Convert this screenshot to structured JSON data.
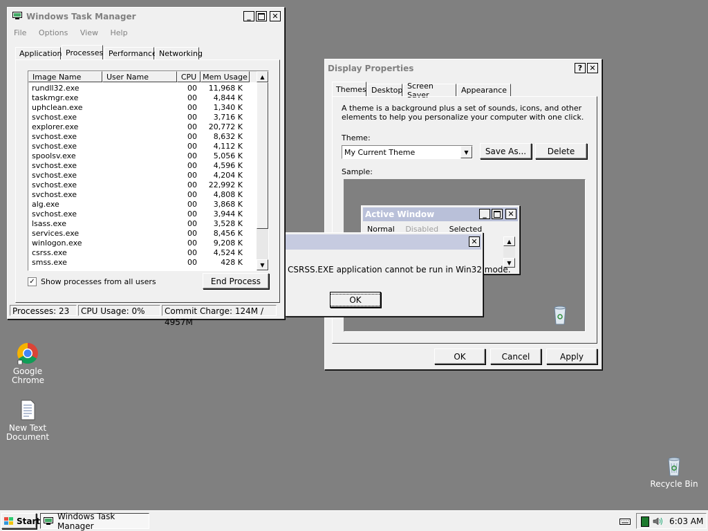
{
  "task_manager": {
    "title": "Windows Task Manager",
    "menu": [
      "File",
      "Options",
      "View",
      "Help"
    ],
    "tabs": [
      "Applications",
      "Processes",
      "Performance",
      "Networking"
    ],
    "columns": [
      "Image Name",
      "User Name",
      "CPU",
      "Mem Usage"
    ],
    "rows": [
      {
        "name": "rundll32.exe",
        "user": "",
        "cpu": "00",
        "mem": "11,968 K"
      },
      {
        "name": "taskmgr.exe",
        "user": "",
        "cpu": "00",
        "mem": "4,844 K"
      },
      {
        "name": "uphclean.exe",
        "user": "",
        "cpu": "00",
        "mem": "1,340 K"
      },
      {
        "name": "svchost.exe",
        "user": "",
        "cpu": "00",
        "mem": "3,716 K"
      },
      {
        "name": "explorer.exe",
        "user": "",
        "cpu": "00",
        "mem": "20,772 K"
      },
      {
        "name": "svchost.exe",
        "user": "",
        "cpu": "00",
        "mem": "8,632 K"
      },
      {
        "name": "svchost.exe",
        "user": "",
        "cpu": "00",
        "mem": "4,112 K"
      },
      {
        "name": "spoolsv.exe",
        "user": "",
        "cpu": "00",
        "mem": "5,056 K"
      },
      {
        "name": "svchost.exe",
        "user": "",
        "cpu": "00",
        "mem": "4,596 K"
      },
      {
        "name": "svchost.exe",
        "user": "",
        "cpu": "00",
        "mem": "4,204 K"
      },
      {
        "name": "svchost.exe",
        "user": "",
        "cpu": "00",
        "mem": "22,992 K"
      },
      {
        "name": "svchost.exe",
        "user": "",
        "cpu": "00",
        "mem": "4,808 K"
      },
      {
        "name": "alg.exe",
        "user": "",
        "cpu": "00",
        "mem": "3,868 K"
      },
      {
        "name": "svchost.exe",
        "user": "",
        "cpu": "00",
        "mem": "3,944 K"
      },
      {
        "name": "lsass.exe",
        "user": "",
        "cpu": "00",
        "mem": "3,528 K"
      },
      {
        "name": "services.exe",
        "user": "",
        "cpu": "00",
        "mem": "8,456 K"
      },
      {
        "name": "winlogon.exe",
        "user": "",
        "cpu": "00",
        "mem": "9,208 K"
      },
      {
        "name": "csrss.exe",
        "user": "",
        "cpu": "00",
        "mem": "4,524 K"
      },
      {
        "name": "smss.exe",
        "user": "",
        "cpu": "00",
        "mem": "428 K"
      }
    ],
    "show_all_label": "Show processes from all users",
    "show_all_checked": true,
    "end_process_label": "End Process",
    "status": {
      "processes": "Processes: 23",
      "cpu": "CPU Usage: 0%",
      "commit": "Commit Charge: 124M / 4957M"
    }
  },
  "display_properties": {
    "title": "Display Properties",
    "tabs": [
      "Themes",
      "Desktop",
      "Screen Saver",
      "Appearance"
    ],
    "description": "A theme is a background plus a set of sounds, icons, and other elements to help you personalize your computer with one click.",
    "theme_label": "Theme:",
    "theme_value": "My Current Theme",
    "save_as_label": "Save As...",
    "delete_label": "Delete",
    "sample_label": "Sample:",
    "sample_window_title": "Active Window",
    "sample_tabs": [
      "Normal",
      "Disabled",
      "Selected"
    ],
    "ok_label": "OK",
    "cancel_label": "Cancel",
    "apply_label": "Apply"
  },
  "error_dialog": {
    "title": "",
    "message": "CSRSS.EXE application cannot be run in Win32 mode.",
    "ok_label": "OK"
  },
  "desktop": {
    "icons": [
      {
        "label": "Google Chrome",
        "icon": "chrome-icon"
      },
      {
        "label": "New Text Document",
        "icon": "text-document-icon"
      },
      {
        "label": "Recycle Bin",
        "icon": "recycle-bin-icon"
      }
    ]
  },
  "taskbar": {
    "start_label": "Start",
    "task_button_label": "Windows Task Manager",
    "clock": "6:03 AM"
  },
  "colors": {
    "desktop": "#808080",
    "window": "#f0f0f0",
    "title_inactive": "#d4d0c8",
    "title_text_disabled": "#808080",
    "sample_active_title": "#b9c0d9"
  }
}
